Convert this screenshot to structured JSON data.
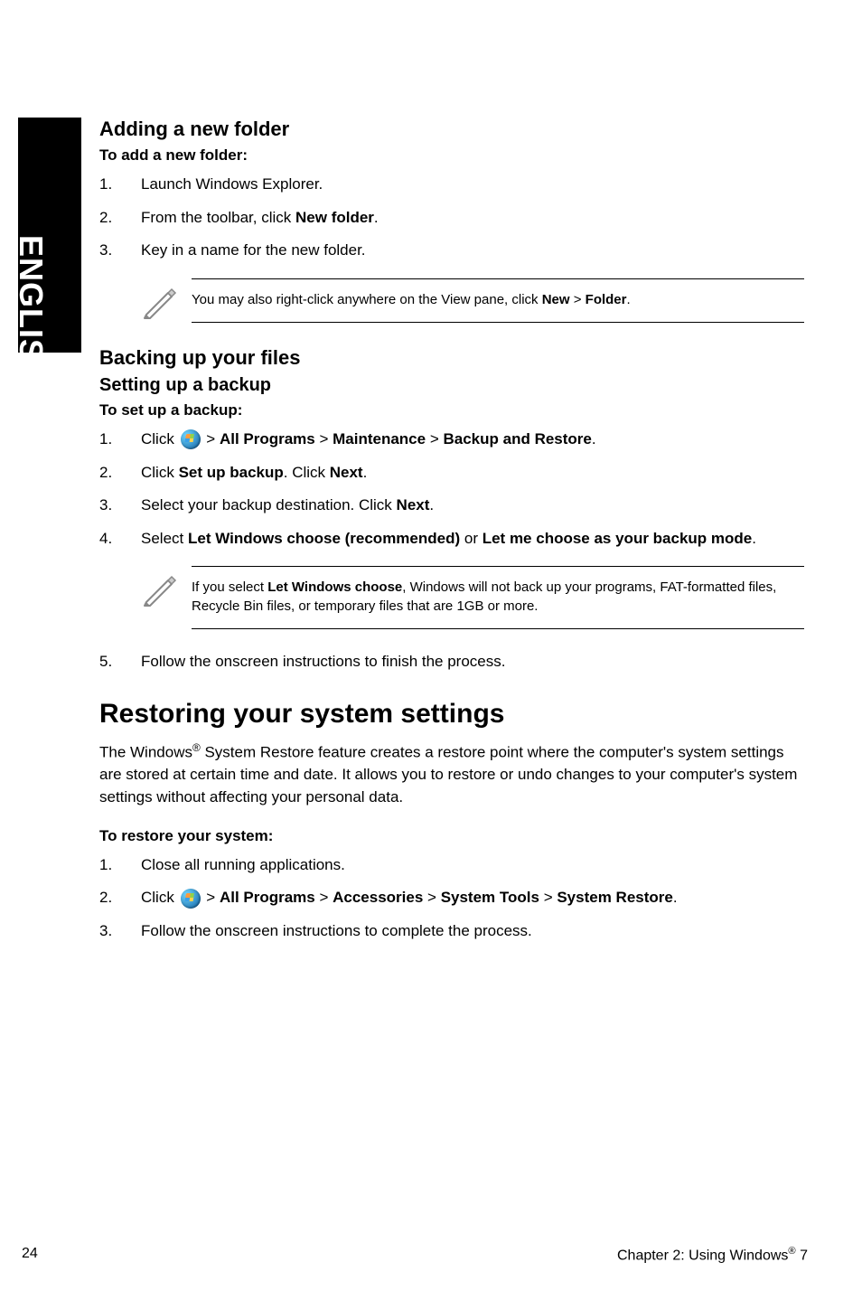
{
  "side_label": "ENGLISH",
  "s1": {
    "title": "Adding a new folder",
    "prompt": "To add a new folder:",
    "steps": [
      "Launch Windows Explorer.",
      "From the toolbar, click <b>New folder</b>.",
      "Key in a name for the new folder."
    ],
    "note": "You may also right-click anywhere on the View pane, click <b>New</b> > <b>Folder</b>."
  },
  "s2": {
    "title": "Backing up your files",
    "subtitle": "Setting up a backup",
    "prompt": "To set up a backup:",
    "steps": [
      "Click {WIN} > <b>All Programs</b> > <b>Maintenance</b> > <b>Backup and Restore</b>.",
      "Click <b>Set up backup</b>. Click <b>Next</b>.",
      "Select your backup destination. Click <b>Next</b>.",
      "Select <b>Let Windows choose (recommended)</b> or <b>Let me choose as your backup mode</b>."
    ],
    "note": "If you select <b>Let Windows choose</b>, Windows will not back up your programs, FAT-formatted files, Recycle Bin files, or temporary files that are 1GB or more.",
    "after_step": "Follow the onscreen instructions to finish the process.",
    "after_step_num": "5."
  },
  "s3": {
    "title": "Restoring your system settings",
    "intro": "The Windows<sup>®</sup> System Restore feature creates a restore point where the computer's system settings are stored at certain time and date. It allows you to restore or undo changes to your computer's system settings without affecting your personal data.",
    "prompt": "To restore your system:",
    "steps": [
      "Close all running applications.",
      "Click {WIN} > <b>All Programs</b> > <b>Accessories</b> > <b>System Tools</b> > <b>System Restore</b>.",
      "Follow the onscreen instructions to complete the process."
    ]
  },
  "footer": {
    "page": "24",
    "chapter": "Chapter 2: Using Windows<sup>®</sup> 7"
  },
  "icons": {
    "pencil": "pencil-note-icon",
    "windows": "windows-start-icon"
  }
}
